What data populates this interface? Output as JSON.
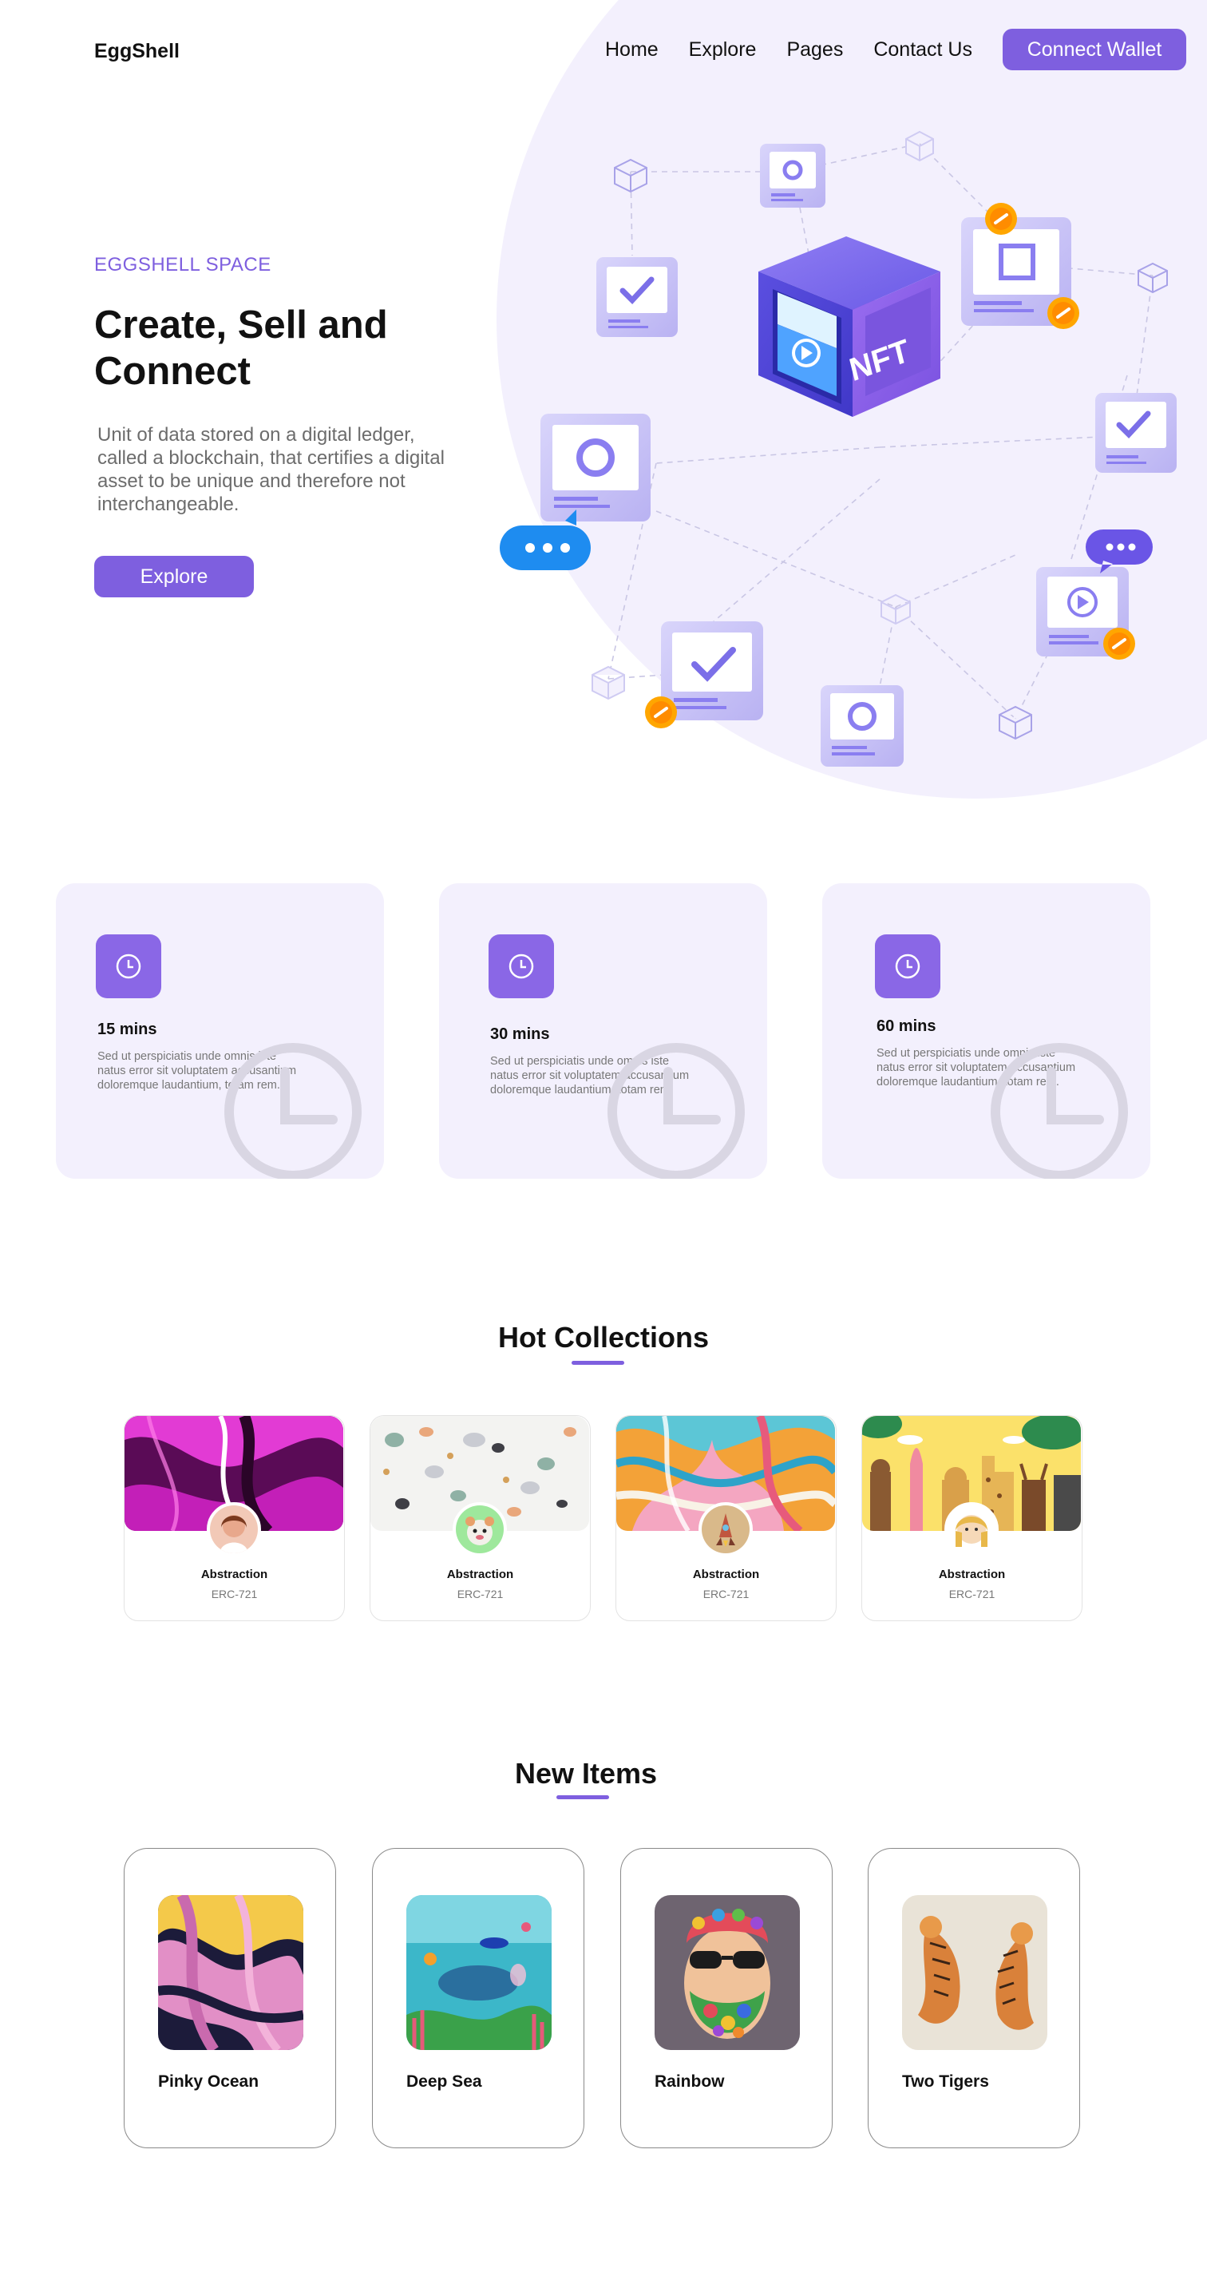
{
  "header": {
    "logo": "EggShell",
    "nav": [
      "Home",
      "Explore",
      "Pages",
      "Contact Us"
    ],
    "cta": "Connect Wallet"
  },
  "hero": {
    "eyebrow": "EGGSHELL SPACE",
    "title": "Create, Sell and Connect",
    "text": "Unit of data stored on a digital ledger, called a blockchain, that certifies a digital asset to be unique and therefore not interchangeable.",
    "button": "Explore",
    "illustration_label": "NFT"
  },
  "features": [
    {
      "title": "15 mins",
      "text": "Sed ut perspiciatis unde omnis iste natus error sit voluptatem accusantium doloremque laudantium, totam rem.",
      "icon": "clock-icon"
    },
    {
      "title": "30 mins",
      "text": "Sed ut perspiciatis unde omnis iste natus error sit voluptatem accusantium doloremque laudantium, totam rem.",
      "icon": "clock-icon"
    },
    {
      "title": "60 mins",
      "text": "Sed ut perspiciatis unde omnis iste natus error sit voluptatem accusantium doloremque laudantium, totam rem.",
      "icon": "clock-icon"
    }
  ],
  "hot_collections": {
    "title": "Hot Collections",
    "items": [
      {
        "name": "Abstraction",
        "standard": "ERC-721"
      },
      {
        "name": "Abstraction",
        "standard": "ERC-721"
      },
      {
        "name": "Abstraction",
        "standard": "ERC-721"
      },
      {
        "name": "Abstraction",
        "standard": "ERC-721"
      }
    ]
  },
  "new_items": {
    "title": "New Items",
    "items": [
      {
        "name": "Pinky Ocean"
      },
      {
        "name": "Deep Sea"
      },
      {
        "name": "Rainbow"
      },
      {
        "name": "Two Tigers"
      }
    ]
  },
  "colors": {
    "accent": "#7e5fdf",
    "hero_bg": "#f3f0fd",
    "card_bg": "#f3f0fd"
  }
}
